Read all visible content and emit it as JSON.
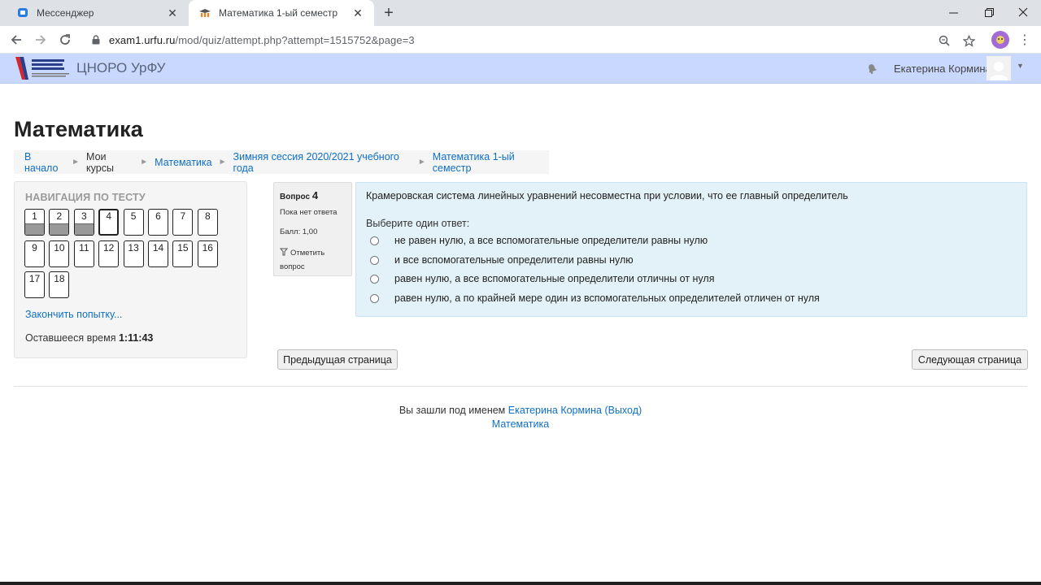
{
  "browser": {
    "tabs": [
      {
        "title": "Мессенджер",
        "icon": "messenger-icon",
        "active": false
      },
      {
        "title": "Математика 1-ый семестр",
        "icon": "moodle-icon",
        "active": true
      }
    ],
    "url_host": "exam1.urfu.ru",
    "url_path": "/mod/quiz/attempt.php?attempt=1515752&page=3"
  },
  "site": {
    "brand": "ЦНОРО УрФУ",
    "user": "Екатерина Кормина"
  },
  "page": {
    "title": "Математика"
  },
  "breadcrumb": {
    "home": "В начало",
    "my_courses": "Мои курсы",
    "course": "Математика",
    "category": "Зимняя сессия 2020/2021 учебного года",
    "quiz": "Математика 1-ый семестр"
  },
  "quiz_nav": {
    "heading": "НАВИГАЦИЯ ПО ТЕСТУ",
    "questions": [
      {
        "n": "1",
        "answered": true
      },
      {
        "n": "2",
        "answered": true
      },
      {
        "n": "3",
        "answered": true
      },
      {
        "n": "4",
        "answered": false,
        "current": true
      },
      {
        "n": "5",
        "answered": false
      },
      {
        "n": "6",
        "answered": false
      },
      {
        "n": "7",
        "answered": false
      },
      {
        "n": "8",
        "answered": false
      },
      {
        "n": "9",
        "answered": false
      },
      {
        "n": "10",
        "answered": false
      },
      {
        "n": "11",
        "answered": false
      },
      {
        "n": "12",
        "answered": false
      },
      {
        "n": "13",
        "answered": false
      },
      {
        "n": "14",
        "answered": false
      },
      {
        "n": "15",
        "answered": false
      },
      {
        "n": "16",
        "answered": false
      },
      {
        "n": "17",
        "answered": false
      },
      {
        "n": "18",
        "answered": false
      }
    ],
    "finish_link": "Закончить попытку...",
    "time_label": "Оставшееся время",
    "time_value": "1:11:43"
  },
  "question": {
    "label": "Вопрос",
    "number": "4",
    "state": "Пока нет ответа",
    "grade": "Балл: 1,00",
    "flag": "Отметить вопрос",
    "text": "Крамеровская система линейных уравнений несовместна при условии, что ее главный определитель",
    "prompt": "Выберите один ответ:",
    "answers": [
      "не равен нулю, а все вспомогательные определители равны нулю",
      "и все вспомогательные определители равны нулю",
      "равен нулю, а все вспомогательные определители отличны от нуля",
      "равен нулю, а по крайней мере один из вспомогательных определителей отличен от нуля"
    ]
  },
  "buttons": {
    "prev": "Предыдущая страница",
    "next": "Следующая страница"
  },
  "footer": {
    "logged_in_as": "Вы зашли под именем",
    "user": "Екатерина Кормина",
    "logout": "(Выход)",
    "course": "Математика"
  }
}
